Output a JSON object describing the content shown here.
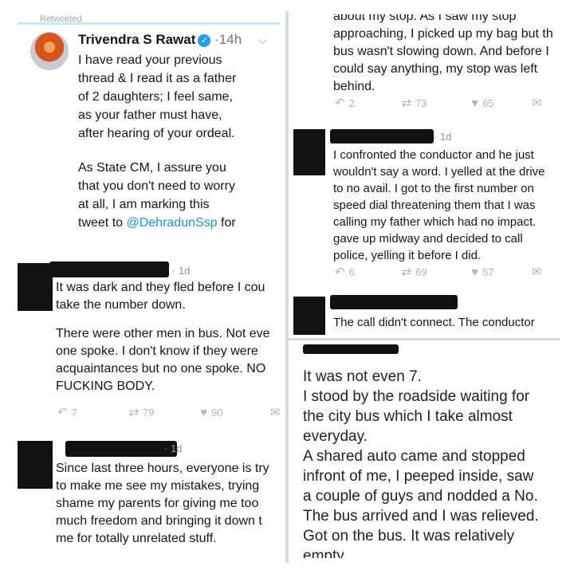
{
  "cm_tweet": {
    "retweet_header": "Retweeted",
    "author": "Trivendra S Rawat",
    "time": "14h",
    "lines": [
      "I have read your previous",
      "thread & I read it as a father",
      "of 2 daughters; I feel same,",
      "as your father must have,",
      "after hearing of your ordeal."
    ],
    "lines2": [
      "As State CM, I assure you",
      "that you don't need to worry",
      "at all, I am marking this"
    ],
    "last_prefix": "tweet to ",
    "mention": "@DehradunSsp",
    "last_suffix": " for"
  },
  "reply_dark": {
    "time": "1d",
    "lines": [
      "It was dark and they fled before I cou",
      "take the number down."
    ],
    "lines2": [
      "There were other men in bus. Not eve",
      "one spoke. I don't know if they were",
      "acquaintances but no one spoke. NO",
      "FUCKING BODY."
    ],
    "replies": "7",
    "retweets": "79",
    "likes": "90"
  },
  "reply_three_hours": {
    "time": "1d",
    "lines": [
      "Since last three hours, everyone is try",
      "to make me see my mistakes, trying",
      "shame my parents for giving me too",
      "much freedom and bringing it down t",
      "me for totally unrelated stuff."
    ]
  },
  "reply_stop": {
    "lines": [
      "about my stop. As I saw my stop",
      "approaching, I picked up my bag but th",
      "bus wasn't slowing down. And before I",
      "could say anything, my stop was left",
      "behind."
    ],
    "replies": "2",
    "retweets": "73",
    "likes": "65"
  },
  "reply_conductor": {
    "time": "1d",
    "lines": [
      "I confronted the conductor and he just",
      "wouldn't say a word. I yelled at the drive",
      "to no avail. I got to the first number on",
      "speed dial threatening them that I was",
      "calling my father which had no impact.",
      "gave up midway and decided to call",
      "police, yelling it before I did."
    ],
    "replies": "6",
    "retweets": "69",
    "likes": "57"
  },
  "reply_call": {
    "lines": [
      "The call didn't connect. The conductor"
    ]
  },
  "note_text": {
    "lines": [
      "It was not even 7.",
      "I stood by the roadside waiting for",
      "the city bus which I take almost",
      "everyday.",
      "A shared auto came and stopped",
      "infront of me, I peeped inside, saw",
      "a couple of guys and nodded a No.",
      "The bus arrived and I was relieved.",
      "Got on the bus. It was relatively",
      "empty"
    ]
  },
  "icons": {
    "reply": "reply-icon",
    "retweet": "retweet-icon",
    "like": "heart-icon",
    "dm": "envelope-icon",
    "verified": "verified-badge-icon"
  },
  "colors": {
    "link": "#1b95e0",
    "verified": "#1da1f2",
    "muted": "#8899a6",
    "redaction": "#111111"
  }
}
